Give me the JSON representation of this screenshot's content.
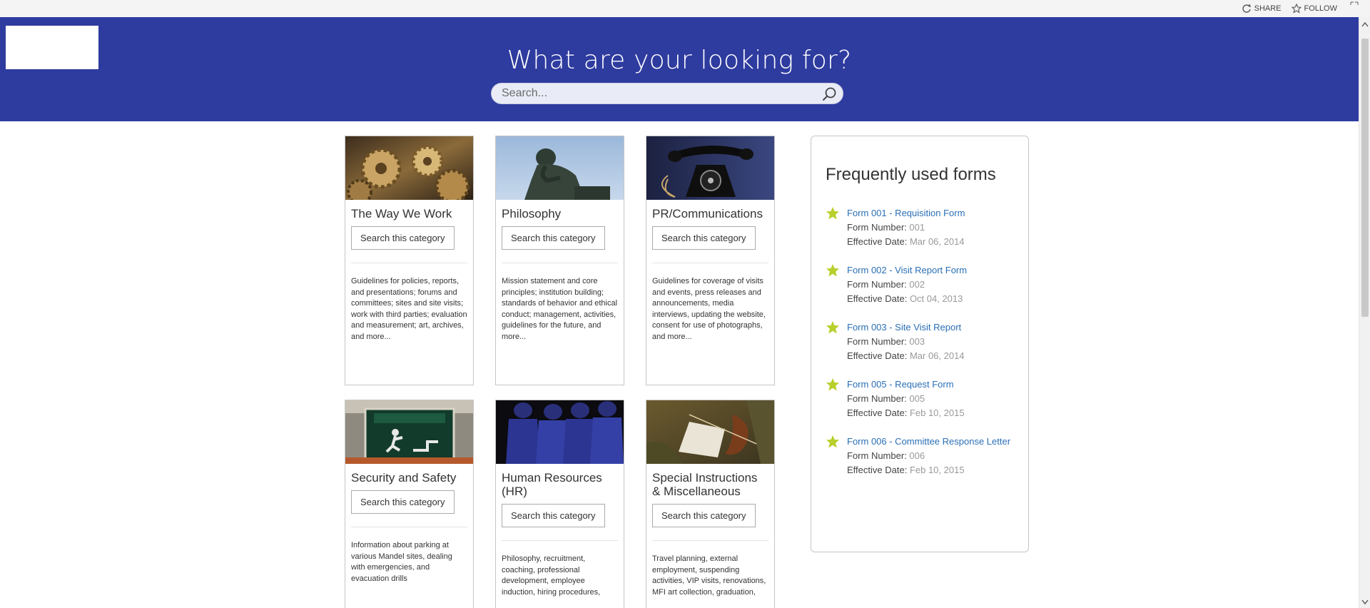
{
  "suite": {
    "share_label": "SHARE",
    "follow_label": "FOLLOW"
  },
  "header": {
    "title": "What are your looking for?",
    "search_placeholder": "Search..."
  },
  "categories": [
    {
      "title": "The Way We Work",
      "button": "Search this category",
      "image": "gears-image",
      "description": "Guidelines for policies, reports, and presentations; forums and committees; sites and site visits; work with third parties; evaluation and measurement; art, archives, and more..."
    },
    {
      "title": "Philosophy",
      "button": "Search this category",
      "image": "thinker-statue-image",
      "description": "Mission statement and core principles; institution building; standards of behavior and ethical conduct; management, activities, guidelines for the future, and more..."
    },
    {
      "title": "PR/Communications",
      "button": "Search this category",
      "image": "vintage-telephone-image",
      "description": "Guidelines for coverage of visits and events, press releases and announcements, media interviews, updating the website, consent for use of photographs, and more..."
    },
    {
      "title": "Security and Safety",
      "button": "Search this category",
      "image": "exit-sign-image",
      "description": "Information about parking at various Mandel sites, dealing with emergencies, and evacuation drills"
    },
    {
      "title": "Human Resources (HR)",
      "button": "Search this category",
      "image": "football-players-image",
      "description": "Philosophy, recruitment, coaching, professional development, employee induction, hiring procedures,"
    },
    {
      "title": "Special Instructions & Miscellaneous",
      "button": "Search this category",
      "image": "violin-orchestra-image",
      "description": "Travel planning, external employment, suspending activities, VIP visits, renovations, MFI art collection, graduation,"
    }
  ],
  "forms": {
    "title": "Frequently used forms",
    "number_label": "Form Number:",
    "date_label": "Effective Date:",
    "items": [
      {
        "link": "Form        001 - Requisition Form",
        "number": "001",
        "date": "Mar 06, 2014"
      },
      {
        "link": "Form        002 - Visit Report Form",
        "number": "002",
        "date": "Oct 04, 2013"
      },
      {
        "link": "Form 003 - Site Visit Report",
        "number": "003",
        "date": "Mar 06, 2014"
      },
      {
        "link": "Form 005 - Request Form",
        "number": "005",
        "date": "Feb 10, 2015"
      },
      {
        "link": "Form 006 - Committee Response Letter",
        "number": "006",
        "date": "Feb 10, 2015"
      }
    ]
  },
  "colors": {
    "header_bg": "#2e3b9f",
    "link": "#2a6fb6",
    "star": "#b9cf2b"
  }
}
